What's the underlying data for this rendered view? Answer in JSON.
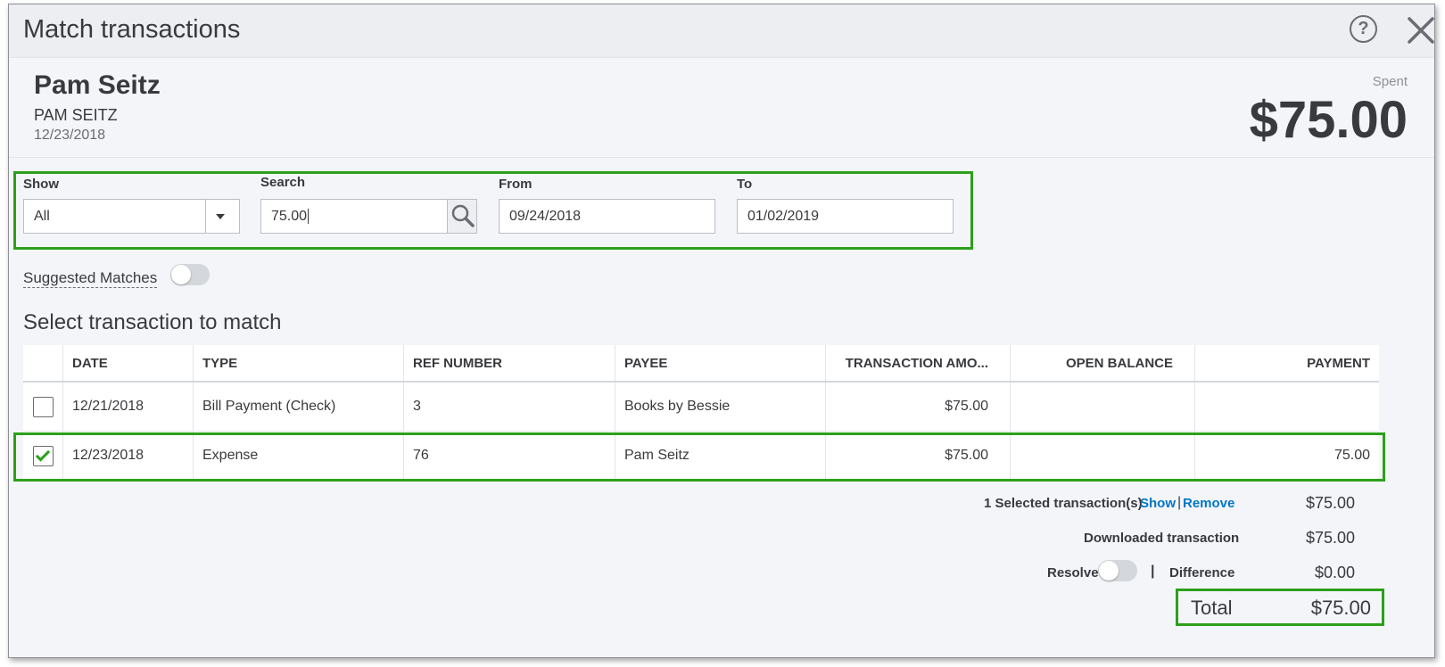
{
  "dialog": {
    "title": "Match transactions",
    "help_label": "?"
  },
  "header": {
    "payee_name": "Pam Seitz",
    "payee_upper": "PAM SEITZ",
    "date": "12/23/2018",
    "spent_label": "Spent",
    "spent_amount": "$75.00"
  },
  "filters": {
    "show_label": "Show",
    "show_value": "All",
    "search_label": "Search",
    "search_value": "75.00",
    "from_label": "From",
    "from_value": "09/24/2018",
    "to_label": "To",
    "to_value": "01/02/2019"
  },
  "suggested_matches_label": "Suggested Matches",
  "section_title": "Select transaction to match",
  "table": {
    "columns": [
      "DATE",
      "TYPE",
      "REF NUMBER",
      "PAYEE",
      "TRANSACTION AMO...",
      "OPEN BALANCE",
      "PAYMENT"
    ],
    "rows": [
      {
        "checked": false,
        "date": "12/21/2018",
        "type": "Bill Payment (Check)",
        "ref": "3",
        "payee": "Books by Bessie",
        "amount": "$75.00",
        "open_balance": "",
        "payment": ""
      },
      {
        "checked": true,
        "date": "12/23/2018",
        "type": "Expense",
        "ref": "76",
        "payee": "Pam Seitz",
        "amount": "$75.00",
        "open_balance": "",
        "payment": "75.00"
      }
    ]
  },
  "summary": {
    "selected_label": "1 Selected transaction(s)",
    "show_link": "Show",
    "separator": "|",
    "remove_link": "Remove",
    "selected_value": "$75.00",
    "downloaded_label": "Downloaded transaction",
    "downloaded_value": "$75.00",
    "resolve_label": "Resolve",
    "difference_label": "Difference",
    "difference_value": "$0.00",
    "total_label": "Total",
    "total_value": "$75.00"
  },
  "colors": {
    "accent_green": "#2ca01c",
    "link_blue": "#0077c5"
  }
}
